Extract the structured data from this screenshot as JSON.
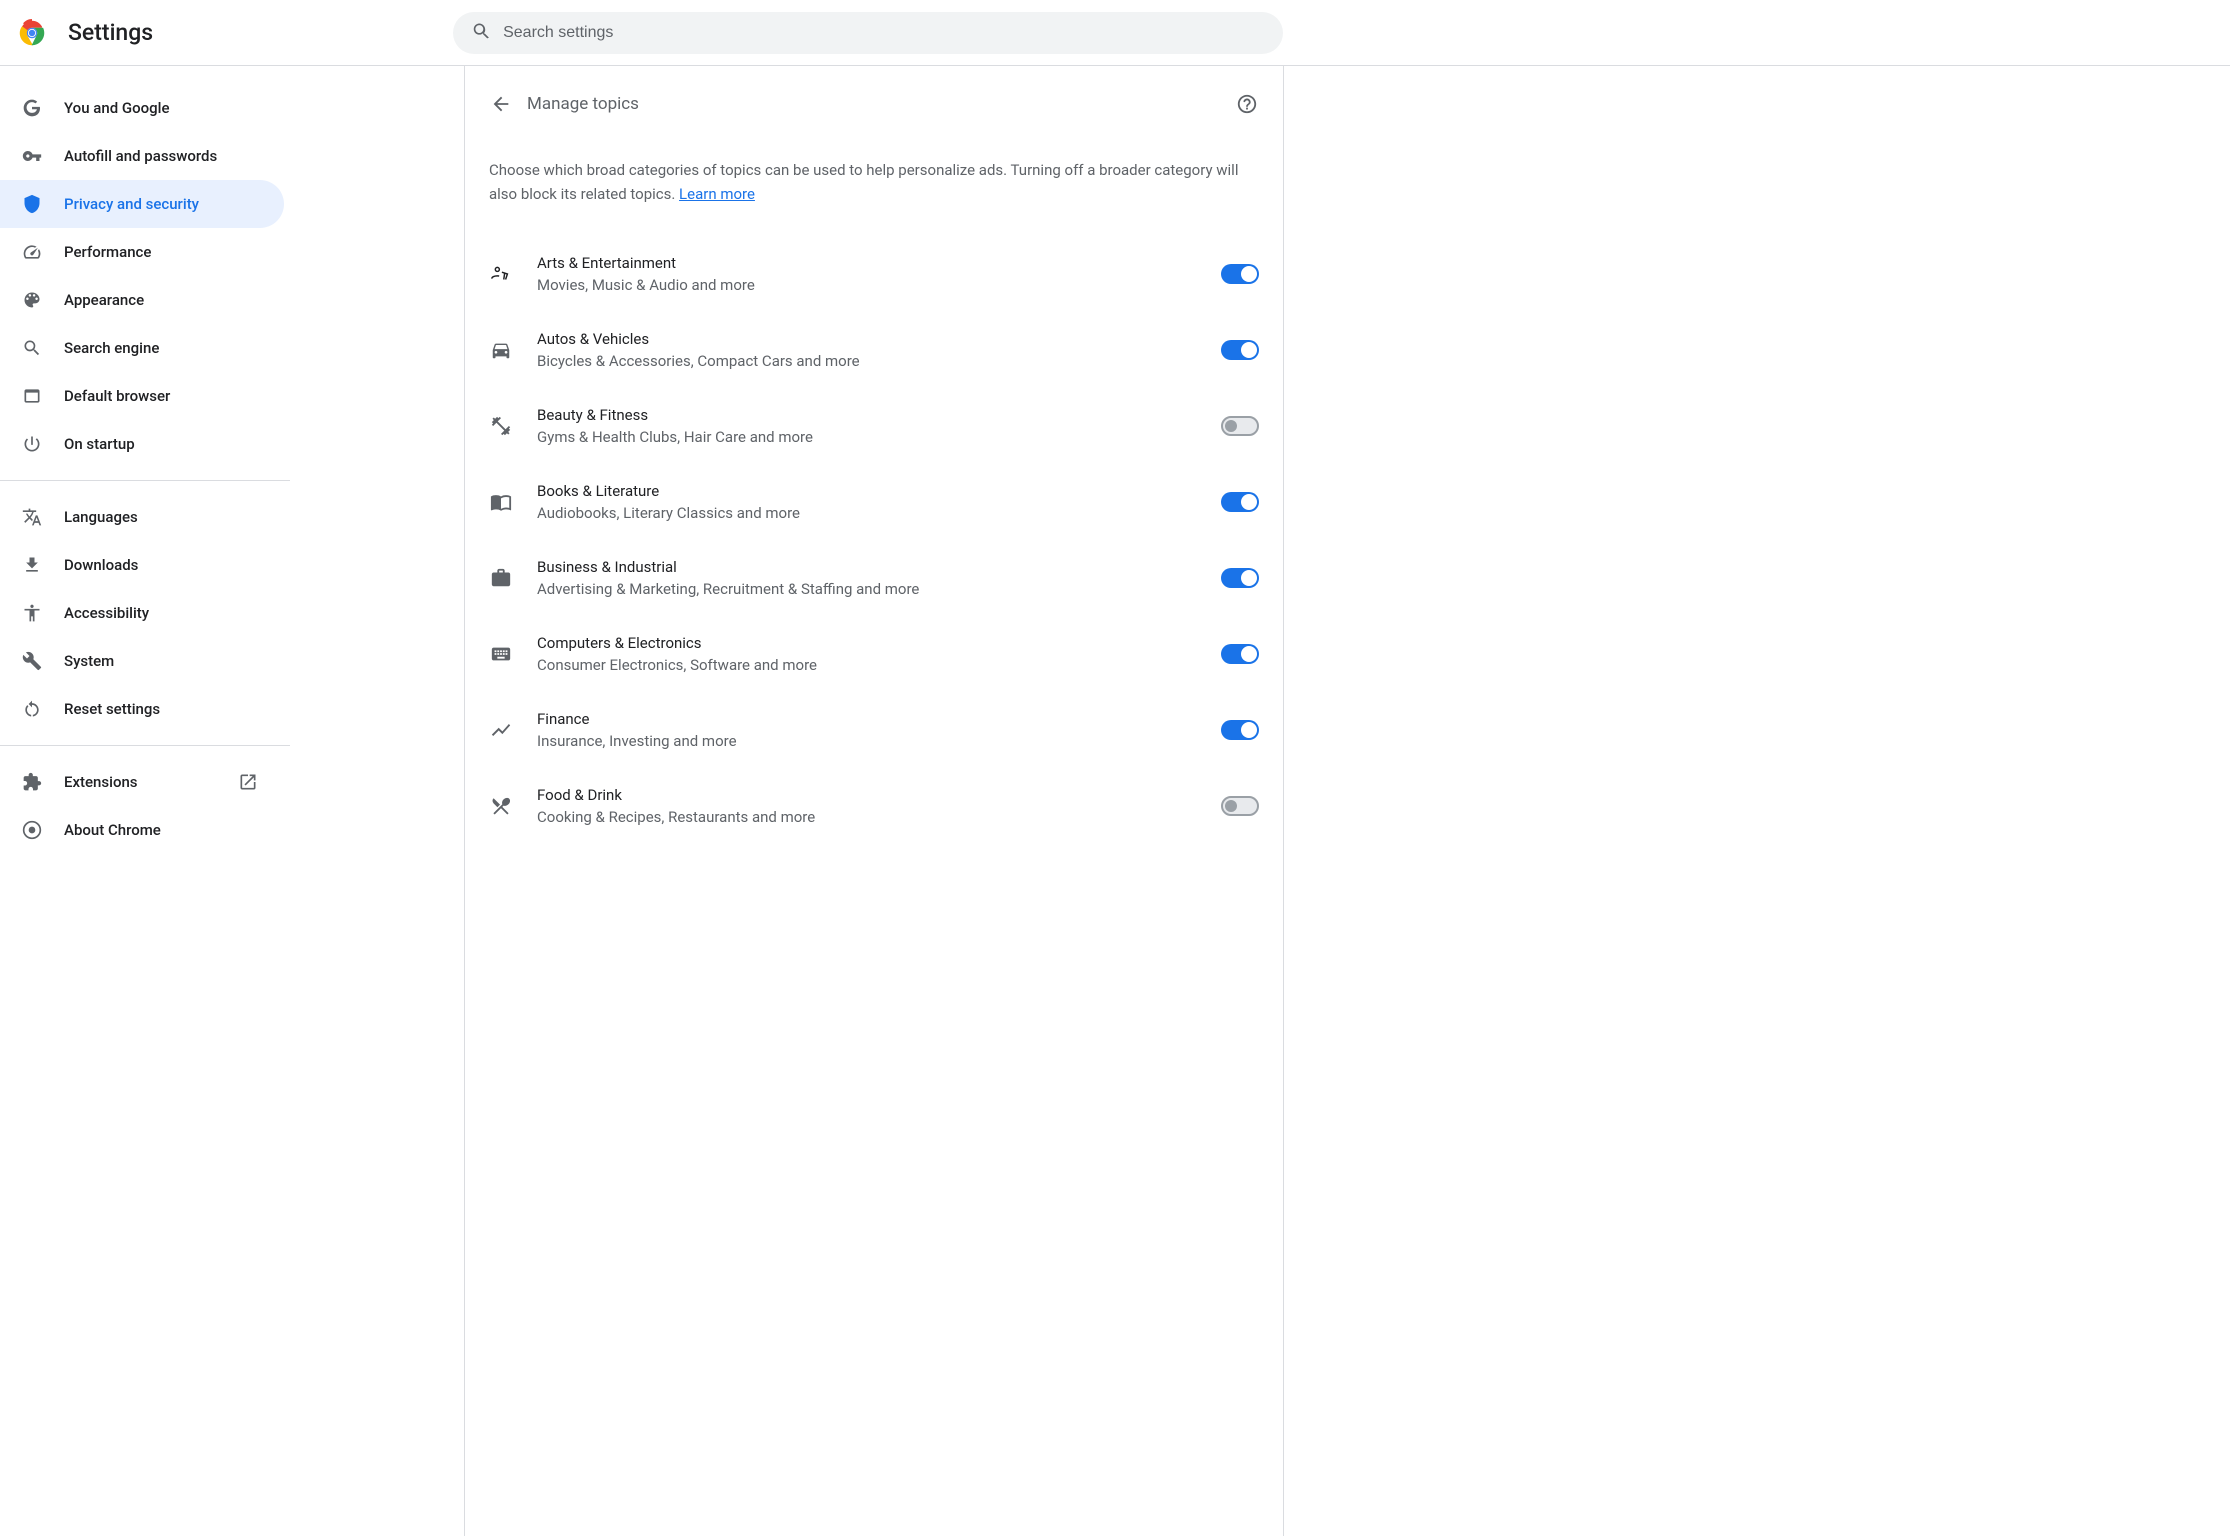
{
  "header": {
    "title": "Settings",
    "search_placeholder": "Search settings"
  },
  "sidebar": {
    "groups": [
      [
        {
          "id": "you-google",
          "label": "You and Google",
          "icon": "google"
        },
        {
          "id": "autofill",
          "label": "Autofill and passwords",
          "icon": "key"
        },
        {
          "id": "privacy",
          "label": "Privacy and security",
          "icon": "shield",
          "active": true
        },
        {
          "id": "performance",
          "label": "Performance",
          "icon": "speed"
        },
        {
          "id": "appearance",
          "label": "Appearance",
          "icon": "palette"
        },
        {
          "id": "search-engine",
          "label": "Search engine",
          "icon": "search"
        },
        {
          "id": "default-browser",
          "label": "Default browser",
          "icon": "browser"
        },
        {
          "id": "startup",
          "label": "On startup",
          "icon": "power"
        }
      ],
      [
        {
          "id": "languages",
          "label": "Languages",
          "icon": "translate"
        },
        {
          "id": "downloads",
          "label": "Downloads",
          "icon": "download"
        },
        {
          "id": "accessibility",
          "label": "Accessibility",
          "icon": "accessibility"
        },
        {
          "id": "system",
          "label": "System",
          "icon": "build"
        },
        {
          "id": "reset",
          "label": "Reset settings",
          "icon": "reset"
        }
      ],
      [
        {
          "id": "extensions",
          "label": "Extensions",
          "icon": "extension",
          "external": true
        },
        {
          "id": "about",
          "label": "About Chrome",
          "icon": "chrome"
        }
      ]
    ]
  },
  "page": {
    "title": "Manage topics",
    "description": "Choose which broad categories of topics can be used to help personalize ads. Turning off a broader category will also block its related topics. ",
    "learn_more": "Learn more"
  },
  "topics": [
    {
      "icon": "arts",
      "title": "Arts & Entertainment",
      "sub": "Movies, Music & Audio and more",
      "on": true
    },
    {
      "icon": "car",
      "title": "Autos & Vehicles",
      "sub": "Bicycles & Accessories, Compact Cars and more",
      "on": true
    },
    {
      "icon": "fitness",
      "title": "Beauty & Fitness",
      "sub": "Gyms & Health Clubs, Hair Care and more",
      "on": false
    },
    {
      "icon": "book",
      "title": "Books & Literature",
      "sub": "Audiobooks, Literary Classics and more",
      "on": true
    },
    {
      "icon": "business",
      "title": "Business & Industrial",
      "sub": "Advertising & Marketing, Recruitment & Staffing and more",
      "on": true
    },
    {
      "icon": "keyboard",
      "title": "Computers & Electronics",
      "sub": "Consumer Electronics, Software and more",
      "on": true
    },
    {
      "icon": "finance",
      "title": "Finance",
      "sub": "Insurance, Investing and more",
      "on": true
    },
    {
      "icon": "food",
      "title": "Food & Drink",
      "sub": "Cooking & Recipes, Restaurants and more",
      "on": false
    }
  ]
}
